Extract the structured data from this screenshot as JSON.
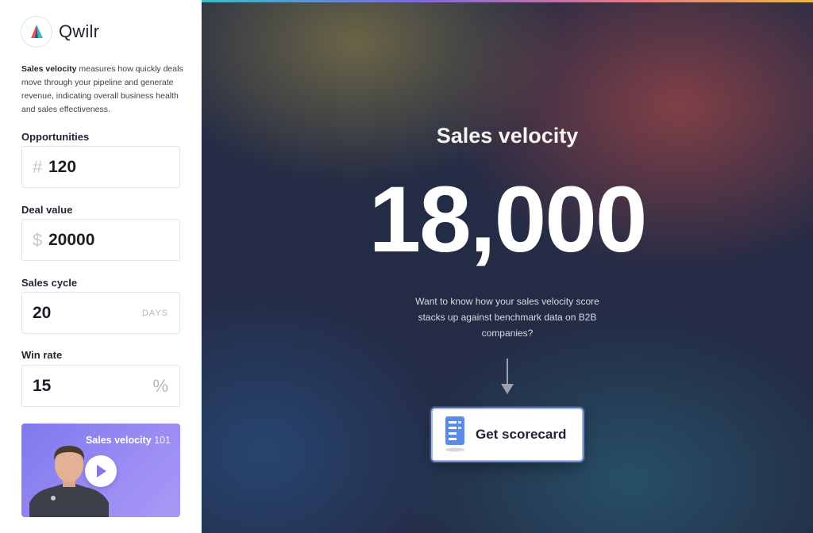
{
  "brand": {
    "name": "Qwilr"
  },
  "intro": {
    "lead": "Sales velocity",
    "text": " measures how quickly deals move through your pipeline and generate revenue, indicating overall business health and sales effectiveness."
  },
  "fields": {
    "opportunities": {
      "label": "Opportunities",
      "prefix": "#",
      "value": "120"
    },
    "deal_value": {
      "label": "Deal value",
      "prefix": "$",
      "value": "20000"
    },
    "sales_cycle": {
      "label": "Sales cycle",
      "value": "20",
      "suffix": "DAYS"
    },
    "win_rate": {
      "label": "Win rate",
      "value": "15",
      "suffix": "%"
    }
  },
  "video": {
    "title_main": "Sales velocity",
    "title_sub": "101"
  },
  "result": {
    "title": "Sales velocity",
    "value": "18,000",
    "cta_text": "Want to know how your sales velocity score stacks up against benchmark data on B2B companies?",
    "button_label": "Get scorecard"
  },
  "colors": {
    "accent_button_border": "#9fb8e8",
    "video_bg": "#8a80f0",
    "panel_bg": "#242b45"
  },
  "icons": [
    "qwilr-logo",
    "hash-icon",
    "dollar-icon",
    "play-icon",
    "arrow-down-icon",
    "scorecard-icon"
  ]
}
